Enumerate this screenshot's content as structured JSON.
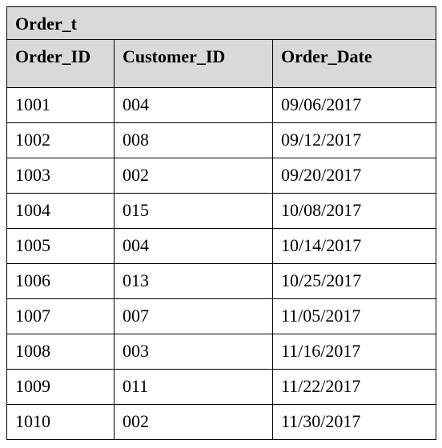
{
  "table": {
    "title": "Order_t",
    "columns": [
      "Order_ID",
      "Customer_ID",
      "Order_Date"
    ],
    "rows": [
      {
        "order_id": "1001",
        "customer_id": "004",
        "order_date": "09/06/2017"
      },
      {
        "order_id": "1002",
        "customer_id": "008",
        "order_date": "09/12/2017"
      },
      {
        "order_id": "1003",
        "customer_id": "002",
        "order_date": "09/20/2017"
      },
      {
        "order_id": "1004",
        "customer_id": "015",
        "order_date": "10/08/2017"
      },
      {
        "order_id": "1005",
        "customer_id": "004",
        "order_date": "10/14/2017"
      },
      {
        "order_id": "1006",
        "customer_id": "013",
        "order_date": "10/25/2017"
      },
      {
        "order_id": "1007",
        "customer_id": "007",
        "order_date": "11/05/2017"
      },
      {
        "order_id": "1008",
        "customer_id": "003",
        "order_date": "11/16/2017"
      },
      {
        "order_id": "1009",
        "customer_id": "011",
        "order_date": "11/22/2017"
      },
      {
        "order_id": "1010",
        "customer_id": "002",
        "order_date": "11/30/2017"
      }
    ]
  }
}
